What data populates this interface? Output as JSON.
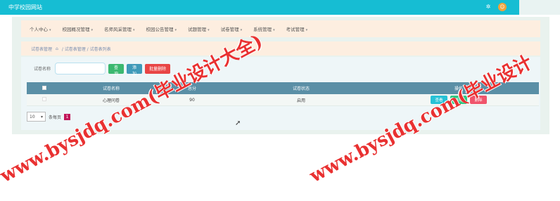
{
  "app": {
    "title": "中学校园网站",
    "gear_icon_glyph": "✲",
    "avatar_glyph": "☺"
  },
  "nav": {
    "items": [
      {
        "label": "个人中心"
      },
      {
        "label": "校园概况管理"
      },
      {
        "label": "名师风采管理"
      },
      {
        "label": "校园公告管理"
      },
      {
        "label": "试题管理"
      },
      {
        "label": "试卷管理"
      },
      {
        "label": "系统管理"
      },
      {
        "label": "考试管理"
      }
    ],
    "caret": "▾"
  },
  "breadcrumb": {
    "page_label": "试卷表管理",
    "home_icon": "⌂",
    "path": "/ 试卷表管理 / 试卷表列表"
  },
  "search": {
    "label": "试卷名称",
    "placeholder": "",
    "value": "",
    "search_btn": "查询",
    "add_btn": "添加",
    "batch_delete_btn": "批量删除"
  },
  "table": {
    "headers": {
      "name": "试卷名称",
      "total": "总分",
      "status": "试卷状态",
      "ops": "操作"
    },
    "rows": [
      {
        "name": "心理问卷",
        "total": "90",
        "status": "启用"
      }
    ],
    "op_labels": {
      "view": "查看",
      "edit": "修改",
      "delete": "删除"
    }
  },
  "pager": {
    "page_size": "10",
    "per_page_label": "条每页",
    "current_page": "1"
  },
  "watermark": {
    "text": "www.bysjdq.com(毕业设计大全)",
    "text2": "www.bysjdq.com(毕业设计"
  },
  "colors": {
    "topbar": "#16bdd3",
    "header_row": "#5a8fa6",
    "btn_search": "#3bb870",
    "btn_add": "#3f9ab9",
    "btn_delete": "#e84545",
    "watermark": "#e61414"
  }
}
